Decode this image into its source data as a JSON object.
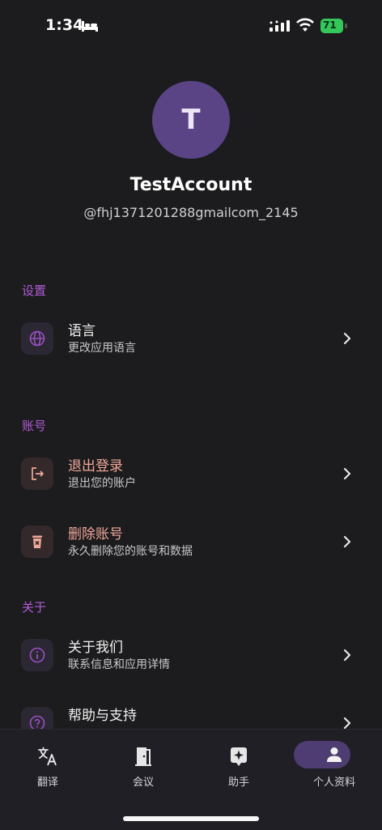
{
  "status": {
    "time": "1:34",
    "battery": "71"
  },
  "profile": {
    "initial": "T",
    "name": "TestAccount",
    "handle": "@fhj1371201288gmailcom_2145"
  },
  "sections": {
    "settings": {
      "title": "设置",
      "language": {
        "title": "语言",
        "subtitle": "更改应用语言"
      }
    },
    "account": {
      "title": "账号",
      "logout": {
        "title": "退出登录",
        "subtitle": "退出您的账户"
      },
      "delete": {
        "title": "删除账号",
        "subtitle": "永久删除您的账号和数据"
      }
    },
    "about": {
      "title": "关于",
      "about_us": {
        "title": "关于我们",
        "subtitle": "联系信息和应用详情"
      },
      "help": {
        "title": "帮助与支持"
      }
    }
  },
  "tabs": {
    "translate": "翻译",
    "meeting": "会议",
    "assistant": "助手",
    "profile": "个人资料"
  },
  "colors": {
    "accent": "#b25bd6",
    "danger": "#f0a89a",
    "avatar": "#5a4486",
    "active_pill": "#4e3d72"
  }
}
